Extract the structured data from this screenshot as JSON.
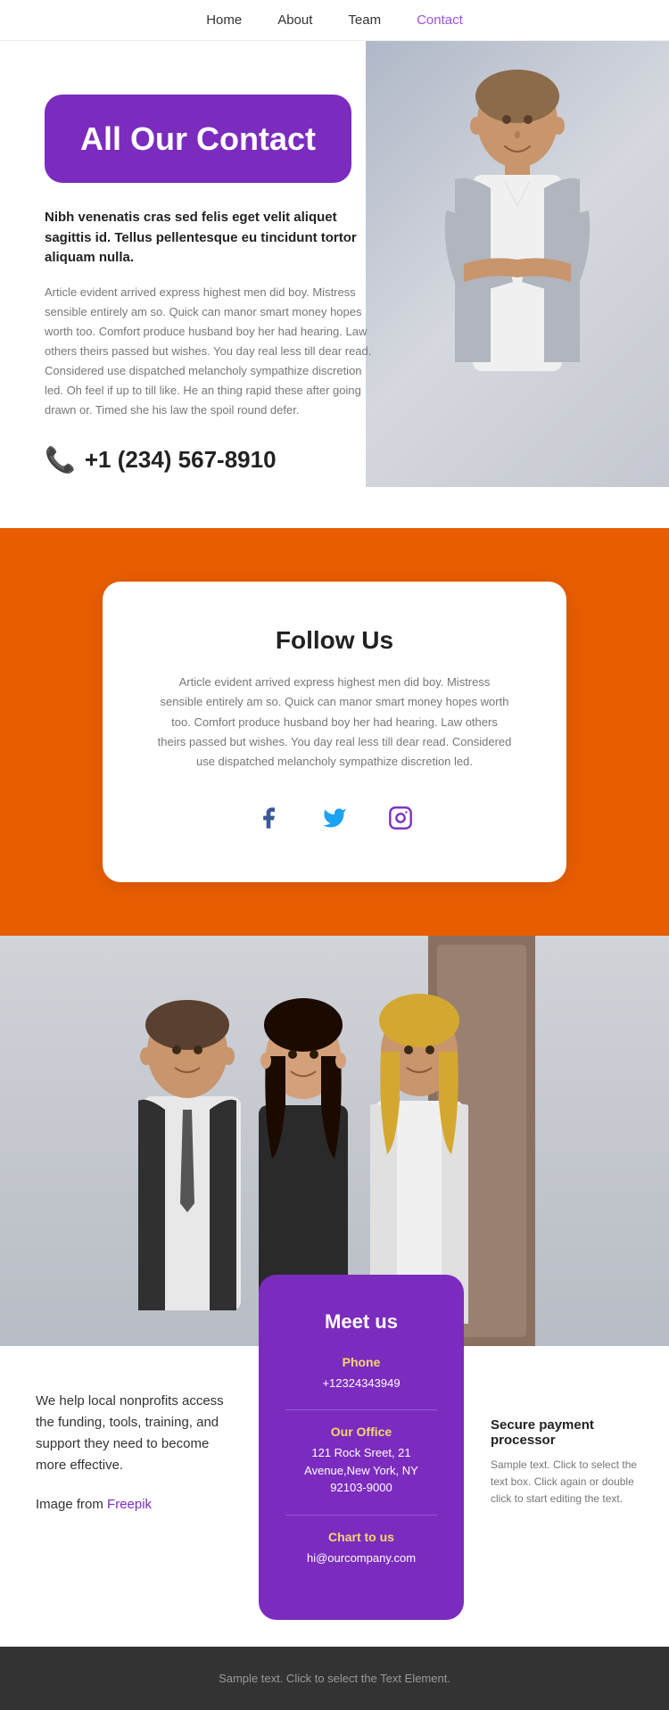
{
  "nav": {
    "items": [
      {
        "label": "Home",
        "active": false
      },
      {
        "label": "About",
        "active": false
      },
      {
        "label": "Team",
        "active": false
      },
      {
        "label": "Contact",
        "active": true
      }
    ]
  },
  "hero": {
    "badge_title": "All Our Contact",
    "subtitle": "Nibh venenatis cras sed felis eget velit aliquet sagittis id. Tellus pellentesque eu tincidunt tortor aliquam nulla.",
    "description": "Article evident arrived express highest men did boy. Mistress sensible entirely am so. Quick can manor smart money hopes worth too. Comfort produce husband boy her had hearing. Law others theirs passed but wishes. You day real less till dear read. Considered use dispatched melancholy sympathize discretion led. Oh feel if up to till like. He an thing rapid these after going drawn or. Timed she his law the spoil round defer.",
    "phone": "+1 (234) 567-8910"
  },
  "follow_us": {
    "title": "Follow Us",
    "description": "Article evident arrived express highest men did boy. Mistress sensible entirely am so. Quick can manor smart money hopes worth too. Comfort produce husband boy her had hearing. Law others theirs passed but wishes. You day real less till dear read. Considered use dispatched melancholy sympathize discretion led.",
    "facebook_icon": "f",
    "twitter_icon": "t",
    "instagram_icon": "ig"
  },
  "meet_us": {
    "card_title": "Meet us",
    "phone_label": "Phone",
    "phone_value": "+12324343949",
    "office_label": "Our Office",
    "office_value": "121 Rock Sreet, 21 Avenue,New York, NY 92103-9000",
    "chat_label": "Chart to us",
    "chat_value": "hi@ourcompany.com"
  },
  "left_text": "We help local nonprofits access the funding, tools, training, and support they need to become more effective.",
  "image_credit_prefix": "Image from ",
  "image_credit_link": "Freepik",
  "secure_payment": {
    "title": "Secure payment processor",
    "description": "Sample text. Click to select the text box. Click again or double click to start editing the text."
  },
  "footer": {
    "text": "Sample text. Click to select the Text Element."
  }
}
